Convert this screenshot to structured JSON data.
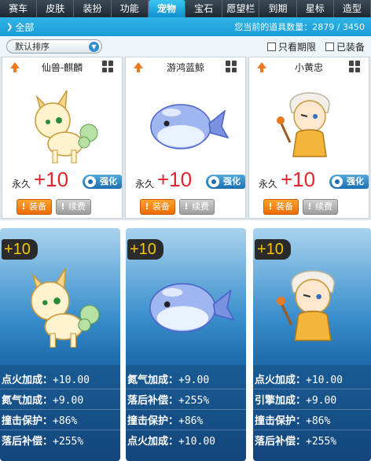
{
  "tabs": [
    {
      "label": "赛车",
      "active": false
    },
    {
      "label": "皮肤",
      "active": false
    },
    {
      "label": "装扮",
      "active": false
    },
    {
      "label": "功能",
      "active": false
    },
    {
      "label": "宠物",
      "active": true
    },
    {
      "label": "宝石",
      "active": false
    },
    {
      "label": "愿望栏",
      "active": false
    },
    {
      "label": "到期",
      "active": false
    },
    {
      "label": "星标",
      "active": false
    },
    {
      "label": "造型",
      "active": false
    }
  ],
  "subbar": {
    "all_label": "全部",
    "count_text": "您当前的道具数量：2879 / 3450"
  },
  "filter": {
    "sort_label": "默认排序",
    "only_expiring": "只看期限",
    "equipped": "已装备"
  },
  "cards": [
    {
      "name": "仙兽-麒麟",
      "perm": "永久",
      "level": "+10",
      "upgrade": "强化",
      "equip": "装备",
      "renew": "续费"
    },
    {
      "name": "游鸿蓝鲸",
      "perm": "永久",
      "level": "+10",
      "upgrade": "强化",
      "equip": "装备",
      "renew": "续费"
    },
    {
      "name": "小黄忠",
      "perm": "永久",
      "level": "+10",
      "upgrade": "强化",
      "equip": "装备",
      "renew": "续费"
    }
  ],
  "panels": [
    {
      "level": "+10",
      "stats": [
        {
          "label": "点火加成：",
          "value": "+10.00"
        },
        {
          "label": "氮气加成：",
          "value": "+9.00"
        },
        {
          "label": "撞击保护：",
          "value": "+86%"
        },
        {
          "label": "落后补偿：",
          "value": "+255%"
        }
      ]
    },
    {
      "level": "+10",
      "stats": [
        {
          "label": "氮气加成：",
          "value": "+9.00"
        },
        {
          "label": "落后补偿：",
          "value": "+255%"
        },
        {
          "label": "撞击保护：",
          "value": "+86%"
        },
        {
          "label": "点火加成：",
          "value": "+10.00"
        }
      ]
    },
    {
      "level": "+10",
      "stats": [
        {
          "label": "点火加成：",
          "value": "+10.00"
        },
        {
          "label": "引擎加成：",
          "value": "+9.00"
        },
        {
          "label": "撞击保护：",
          "value": "+86%"
        },
        {
          "label": "落后补偿：",
          "value": "+255%"
        }
      ]
    }
  ],
  "colors": {
    "accent": "#1a9bd6",
    "level_text": "#e3242b",
    "equip_button": "#ec6b05"
  },
  "icons": [
    "upgrade-arrow-icon",
    "grid-view-icon",
    "gear-icon",
    "chevron-down-icon"
  ]
}
